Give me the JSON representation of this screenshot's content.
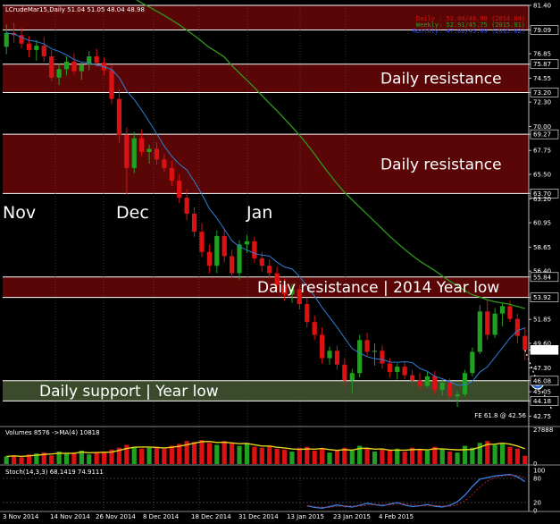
{
  "window": {
    "title": "LCrudeMar15,Daily  51.04 51.05 48.04 48.98"
  },
  "info_lines": [
    "Daily : 51.04/48.98 (2014.04)",
    "Weekly: 52.91/45.75 (2015.01)",
    "Monthly: 47.08/45.09 (2015.02)"
  ],
  "colors": {
    "bull": "#22a022",
    "bear": "#dd1111",
    "zone_resistance": "#5a0606",
    "zone_support": "#3c4a2c",
    "ma_fast": "#2d7fd6",
    "ma_slow": "#2e9a1a",
    "volume_ma": "#e6d21a",
    "stoch_main": "#3b80e6",
    "stoch_signal": "#d12a2a"
  },
  "zones": [
    {
      "label": "",
      "low": 79.09,
      "high": 81.4,
      "type": "resistance"
    },
    {
      "label": "Daily resistance",
      "low": 73.2,
      "high": 75.87,
      "type": "resistance"
    },
    {
      "label": "Daily resistance",
      "low": 63.7,
      "high": 69.27,
      "type": "resistance"
    },
    {
      "label": "Daily resistance | 2014 Year low",
      "low": 53.92,
      "high": 55.84,
      "type": "resistance"
    },
    {
      "label": "Daily support | Year low",
      "low": 44.18,
      "high": 46.08,
      "type": "support"
    }
  ],
  "month_labels": [
    "Nov",
    "Dec",
    "Jan"
  ],
  "fe_label": "FE 61.8 @ 42.56",
  "marker_label": "1",
  "volume_panel": {
    "title": "Volumes 8576  ->MA(4) 10818",
    "ticks": [
      "27888",
      "0"
    ]
  },
  "stoch_panel": {
    "title": "Stoch(14,3,3) 68.1419 74.9111",
    "ticks": [
      "100",
      "80",
      "20",
      "0"
    ]
  },
  "chart_data": {
    "type": "candlestick",
    "title": "LCrudeMar15,Daily",
    "ylim": [
      42.36,
      81.4
    ],
    "y_ticks": [
      "81.40",
      "79.09",
      "76.85",
      "75.87",
      "74.55",
      "73.20",
      "72.30",
      "70.00",
      "69.27",
      "67.75",
      "65.50",
      "63.70",
      "63.20",
      "60.95",
      "58.65",
      "56.40",
      "55.84",
      "53.92",
      "51.85",
      "49.60",
      "48.98",
      "47.30",
      "46.08",
      "45.05",
      "44.18",
      "42.75"
    ],
    "x_ticks": [
      "3 Nov 2014",
      "14 Nov 2014",
      "26 Nov 2014",
      "8 Dec 2014",
      "18 Dec 2014",
      "31 Dec 2014",
      "13 Jan 2015",
      "23 Jan 2015",
      "4 Feb 2015"
    ],
    "candles": [
      [
        77.5,
        79.6,
        76.8,
        78.8
      ],
      [
        78.8,
        79.8,
        77.9,
        78.6
      ],
      [
        78.6,
        79.3,
        77.4,
        77.8
      ],
      [
        77.8,
        78.5,
        76.5,
        77.2
      ],
      [
        77.2,
        78.1,
        76.2,
        77.6
      ],
      [
        77.6,
        78.4,
        76.1,
        76.6
      ],
      [
        76.6,
        77.2,
        74.3,
        74.6
      ],
      [
        74.6,
        75.9,
        73.9,
        75.4
      ],
      [
        75.4,
        76.6,
        74.8,
        76.1
      ],
      [
        76.1,
        76.9,
        74.9,
        75.2
      ],
      [
        75.2,
        76.1,
        74.4,
        75.8
      ],
      [
        75.8,
        77.1,
        75.3,
        76.6
      ],
      [
        76.6,
        77.3,
        75.6,
        76.0
      ],
      [
        76.0,
        76.5,
        74.8,
        75.3
      ],
      [
        75.3,
        75.8,
        72.1,
        72.6
      ],
      [
        72.6,
        73.5,
        68.5,
        69.2
      ],
      [
        69.2,
        69.9,
        63.6,
        66.1
      ],
      [
        66.1,
        69.5,
        65.6,
        68.9
      ],
      [
        68.9,
        69.7,
        67.2,
        67.6
      ],
      [
        67.6,
        68.3,
        66.5,
        67.9
      ],
      [
        67.9,
        68.5,
        66.4,
        66.9
      ],
      [
        66.9,
        67.4,
        65.7,
        66.1
      ],
      [
        66.1,
        66.8,
        64.4,
        64.9
      ],
      [
        64.9,
        65.5,
        62.8,
        63.3
      ],
      [
        63.3,
        64.1,
        61.2,
        61.8
      ],
      [
        61.8,
        62.4,
        59.6,
        60.1
      ],
      [
        60.1,
        60.9,
        57.7,
        58.2
      ],
      [
        58.2,
        58.9,
        56.2,
        56.9
      ],
      [
        56.9,
        60.2,
        56.2,
        59.7
      ],
      [
        59.7,
        60.3,
        57.2,
        57.8
      ],
      [
        57.8,
        58.4,
        55.8,
        56.2
      ],
      [
        56.2,
        59.3,
        55.6,
        58.9
      ],
      [
        58.9,
        59.8,
        58.1,
        59.2
      ],
      [
        59.2,
        59.6,
        57.2,
        57.6
      ],
      [
        57.6,
        58.2,
        56.3,
        56.9
      ],
      [
        56.9,
        57.5,
        55.7,
        56.2
      ],
      [
        56.2,
        56.8,
        54.6,
        55.1
      ],
      [
        55.1,
        55.7,
        53.6,
        54.2
      ],
      [
        54.2,
        55.2,
        53.4,
        54.7
      ],
      [
        54.7,
        55.1,
        52.8,
        53.3
      ],
      [
        53.3,
        53.9,
        51.1,
        51.6
      ],
      [
        51.6,
        52.2,
        49.9,
        50.4
      ],
      [
        50.4,
        51.1,
        47.7,
        48.2
      ],
      [
        48.2,
        49.3,
        47.6,
        48.9
      ],
      [
        48.9,
        49.4,
        47.1,
        47.6
      ],
      [
        47.6,
        48.2,
        45.6,
        46.1
      ],
      [
        46.1,
        47.2,
        44.9,
        46.8
      ],
      [
        46.8,
        50.4,
        46.4,
        49.9
      ],
      [
        49.9,
        50.6,
        48.4,
        48.8
      ],
      [
        48.8,
        49.6,
        47.5,
        48.9
      ],
      [
        48.9,
        49.4,
        47.2,
        47.7
      ],
      [
        47.7,
        48.2,
        46.4,
        46.9
      ],
      [
        46.9,
        47.7,
        46.2,
        47.4
      ],
      [
        47.4,
        47.9,
        46.2,
        46.6
      ],
      [
        46.6,
        47.1,
        45.5,
        46.1
      ],
      [
        46.1,
        46.8,
        45.2,
        45.6
      ],
      [
        45.6,
        46.9,
        45.4,
        46.5
      ],
      [
        46.5,
        47.0,
        44.8,
        45.2
      ],
      [
        45.2,
        46.2,
        44.7,
        45.9
      ],
      [
        45.9,
        46.3,
        44.3,
        44.6
      ],
      [
        44.6,
        45.1,
        43.6,
        44.8
      ],
      [
        44.8,
        47.1,
        44.6,
        46.8
      ],
      [
        46.8,
        49.2,
        46.5,
        48.8
      ],
      [
        48.8,
        53.2,
        48.6,
        52.6
      ],
      [
        52.6,
        53.6,
        49.9,
        50.4
      ],
      [
        50.4,
        52.9,
        50.1,
        52.4
      ],
      [
        52.4,
        53.4,
        51.2,
        53.1
      ],
      [
        53.1,
        53.6,
        51.6,
        51.9
      ],
      [
        51.9,
        52.4,
        49.6,
        50.3
      ],
      [
        50.3,
        51.1,
        48.0,
        48.98
      ]
    ],
    "volume": [
      8,
      9,
      7,
      10,
      11,
      12,
      9,
      13,
      11,
      12,
      14,
      10,
      12,
      13,
      15,
      17,
      20,
      18,
      16,
      17,
      18,
      16,
      19,
      21,
      24,
      23,
      25,
      22,
      20,
      24,
      22,
      19,
      21,
      18,
      17,
      19,
      16,
      15,
      13,
      17,
      18,
      14,
      16,
      12,
      15,
      17,
      14,
      19,
      16,
      13,
      15,
      14,
      16,
      13,
      17,
      15,
      14,
      18,
      16,
      13,
      12,
      19,
      17,
      22,
      24,
      20,
      21,
      18,
      16,
      8.6
    ],
    "stoch": [
      null,
      null,
      null,
      null,
      null,
      null,
      null,
      null,
      null,
      null,
      null,
      null,
      null,
      null,
      null,
      null,
      null,
      null,
      null,
      null,
      null,
      null,
      null,
      null,
      null,
      null,
      null,
      null,
      null,
      null,
      null,
      null,
      null,
      null,
      null,
      null,
      null,
      null,
      null,
      null,
      12,
      8,
      6,
      10,
      14,
      11,
      9,
      13,
      18,
      15,
      12,
      16,
      20,
      14,
      10,
      12,
      15,
      11,
      9,
      13,
      22,
      38,
      60,
      78,
      82,
      86,
      88,
      90,
      84,
      72
    ]
  }
}
